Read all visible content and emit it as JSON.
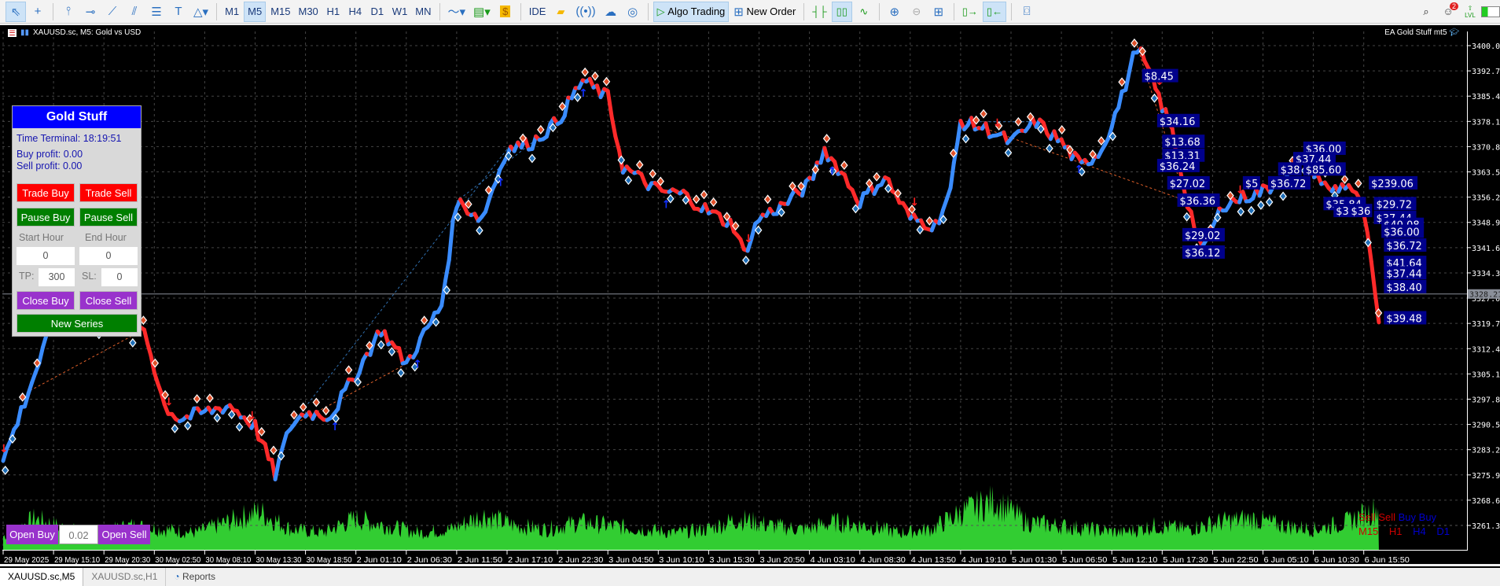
{
  "toolbar": {
    "timeframes": [
      "M1",
      "M5",
      "M15",
      "M30",
      "H1",
      "H4",
      "D1",
      "W1",
      "MN"
    ],
    "active_timeframe": "M5",
    "ide": "IDE",
    "algo_trading": "Algo Trading",
    "new_order": "New Order",
    "notifications": "2",
    "lvl": "LVL"
  },
  "chart": {
    "title": "XAUUSD.sc, M5:  Gold vs USD",
    "ea_name": "EA Gold Stuff mt5",
    "current_price": "3328.21"
  },
  "panel": {
    "title": "Gold Stuff",
    "time_terminal": "Time Terminal: 18:19:51",
    "buy_profit": "Buy profit: 0.00",
    "sell_profit": "Sell profit: 0.00",
    "trade_buy": "Trade Buy",
    "trade_sell": "Trade Sell",
    "pause_buy": "Pause Buy",
    "pause_sell": "Pause Sell",
    "start_hour_label": "Start Hour",
    "end_hour_label": "End Hour",
    "start_hour": "0",
    "end_hour": "0",
    "tp_label": "TP:",
    "tp": "300",
    "sl_label": "SL:",
    "sl": "0",
    "close_buy": "Close Buy",
    "close_sell": "Close Sell",
    "new_series": "New Series"
  },
  "quick": {
    "open_buy": "Open Buy",
    "lot": "0.02",
    "open_sell": "Open Sell"
  },
  "mtf": {
    "signals": [
      "Sell",
      "Sell",
      "Buy",
      "Buy"
    ],
    "timeframes": [
      "M15",
      "H1",
      "H4",
      "D1"
    ]
  },
  "tabs": [
    "XAUUSD.sc,M5",
    "XAUUSD.sc,H1",
    "Reports"
  ],
  "colors": {
    "bull": "#3a8cff",
    "bear": "#ff2a2a",
    "volume": "#32cd32",
    "label_bg": "#00008b"
  },
  "chart_data": {
    "type": "line",
    "price_ticks": [
      "3400.00",
      "3392.70",
      "3385.40",
      "3378.10",
      "3370.80",
      "3363.50",
      "3356.20",
      "3348.90",
      "3341.60",
      "3334.30",
      "3327.00",
      "3319.70",
      "3312.40",
      "3305.10",
      "3297.80",
      "3290.50",
      "3283.20",
      "3275.90",
      "3268.60",
      "3261.30"
    ],
    "ylim": [
      3261.3,
      3400
    ],
    "time_labels": [
      "29 May 2025",
      "29 May 15:10",
      "29 May 20:30",
      "30 May 02:50",
      "30 May 08:10",
      "30 May 13:30",
      "30 May 18:50",
      "2 Jun 01:10",
      "2 Jun 06:30",
      "2 Jun 11:50",
      "2 Jun 17:10",
      "2 Jun 22:30",
      "3 Jun 04:50",
      "3 Jun 10:10",
      "3 Jun 15:30",
      "3 Jun 20:50",
      "4 Jun 03:10",
      "4 Jun 08:30",
      "4 Jun 13:50",
      "4 Jun 19:10",
      "5 Jun 01:30",
      "5 Jun 06:50",
      "5 Jun 12:10",
      "5 Jun 17:30",
      "5 Jun 22:50",
      "6 Jun 05:10",
      "6 Jun 10:30",
      "6 Jun 15:50"
    ],
    "price_path": [
      [
        0,
        3280
      ],
      [
        0.5,
        3300
      ],
      [
        1,
        3320
      ],
      [
        1.5,
        3325
      ],
      [
        2,
        3318
      ],
      [
        2.8,
        3318
      ],
      [
        3.2,
        3296
      ],
      [
        3.5,
        3292
      ],
      [
        4,
        3294
      ],
      [
        4.5,
        3296
      ],
      [
        5,
        3290
      ],
      [
        5.4,
        3276
      ],
      [
        5.7,
        3290
      ],
      [
        6,
        3294
      ],
      [
        6.5,
        3293
      ],
      [
        7,
        3305
      ],
      [
        7.5,
        3318
      ],
      [
        8,
        3308
      ],
      [
        8.7,
        3325
      ],
      [
        9,
        3355
      ],
      [
        9.5,
        3350
      ],
      [
        10,
        3370
      ],
      [
        10.5,
        3372
      ],
      [
        11,
        3378
      ],
      [
        11.5,
        3390
      ],
      [
        12,
        3385
      ],
      [
        12.3,
        3365
      ],
      [
        12.6,
        3362
      ],
      [
        13,
        3358
      ],
      [
        13.5,
        3357
      ],
      [
        14,
        3352
      ],
      [
        14.5,
        3348
      ],
      [
        14.7,
        3340
      ],
      [
        15,
        3350
      ],
      [
        15.5,
        3354
      ],
      [
        16,
        3360
      ],
      [
        16.3,
        3370
      ],
      [
        16.7,
        3362
      ],
      [
        17,
        3355
      ],
      [
        17.5,
        3362
      ],
      [
        18,
        3350
      ],
      [
        18.5,
        3348
      ],
      [
        18.8,
        3358
      ],
      [
        19,
        3378
      ],
      [
        19.5,
        3376
      ],
      [
        20,
        3372
      ],
      [
        20.5,
        3378
      ],
      [
        21,
        3372
      ],
      [
        21.4,
        3365
      ],
      [
        21.8,
        3370
      ],
      [
        22.2,
        3385
      ],
      [
        22.5,
        3400
      ],
      [
        22.8,
        3390
      ],
      [
        23.2,
        3375
      ],
      [
        23.5,
        3355
      ],
      [
        23.8,
        3340
      ],
      [
        24.2,
        3354
      ],
      [
        24.6,
        3356
      ],
      [
        25,
        3358
      ],
      [
        25.5,
        3362
      ],
      [
        25.8,
        3368
      ],
      [
        26.3,
        3358
      ],
      [
        26.7,
        3360
      ],
      [
        27,
        3352
      ],
      [
        27.3,
        3320
      ]
    ],
    "volume_profile": [
      20,
      45,
      30,
      25,
      35,
      30,
      25,
      40,
      55,
      30,
      25,
      45,
      35,
      25,
      30,
      50,
      35,
      30,
      40,
      35,
      30,
      25,
      30,
      45,
      35,
      30,
      40,
      35,
      25,
      30,
      55,
      70,
      40,
      35,
      30,
      25,
      35,
      30,
      40,
      45,
      35,
      30,
      40,
      60
    ],
    "profit_labels": [
      {
        "t": "$8.45",
        "x": 22.6,
        "p": 3391
      },
      {
        "t": "$34.16",
        "x": 22.9,
        "p": 3378
      },
      {
        "t": "$13.68",
        "x": 23.0,
        "p": 3372
      },
      {
        "t": "$13.31",
        "x": 23.0,
        "p": 3368
      },
      {
        "t": "$36.24",
        "x": 22.9,
        "p": 3365
      },
      {
        "t": "$27.02",
        "x": 23.1,
        "p": 3360
      },
      {
        "t": "$36.36",
        "x": 23.3,
        "p": 3355
      },
      {
        "t": "$29.02",
        "x": 23.4,
        "p": 3345
      },
      {
        "t": "$36.12",
        "x": 23.4,
        "p": 3340
      },
      {
        "t": "$5",
        "x": 24.6,
        "p": 3360
      },
      {
        "t": "$36.72",
        "x": 25.1,
        "p": 3360
      },
      {
        "t": "$36.00",
        "x": 25.8,
        "p": 3370
      },
      {
        "t": "$37.44",
        "x": 25.6,
        "p": 3367
      },
      {
        "t": "$38",
        "x": 25.3,
        "p": 3364
      },
      {
        "t": "$85.60",
        "x": 25.8,
        "p": 3364
      },
      {
        "t": "$239.06",
        "x": 27.1,
        "p": 3360
      },
      {
        "t": "$35.84",
        "x": 26.2,
        "p": 3354
      },
      {
        "t": "$36",
        "x": 26.4,
        "p": 3352
      },
      {
        "t": "$36",
        "x": 26.7,
        "p": 3352
      },
      {
        "t": "$29.72",
        "x": 27.2,
        "p": 3354
      },
      {
        "t": "$37.44",
        "x": 27.2,
        "p": 3350
      },
      {
        "t": "$40.08",
        "x": 27.35,
        "p": 3348
      },
      {
        "t": "$36.00",
        "x": 27.35,
        "p": 3346
      },
      {
        "t": "$36.72",
        "x": 27.4,
        "p": 3342
      },
      {
        "t": "$41.64",
        "x": 27.4,
        "p": 3337
      },
      {
        "t": "$37.44",
        "x": 27.4,
        "p": 3334
      },
      {
        "t": "$38.40",
        "x": 27.4,
        "p": 3330
      },
      {
        "t": "$39.48",
        "x": 27.4,
        "p": 3321
      }
    ]
  }
}
